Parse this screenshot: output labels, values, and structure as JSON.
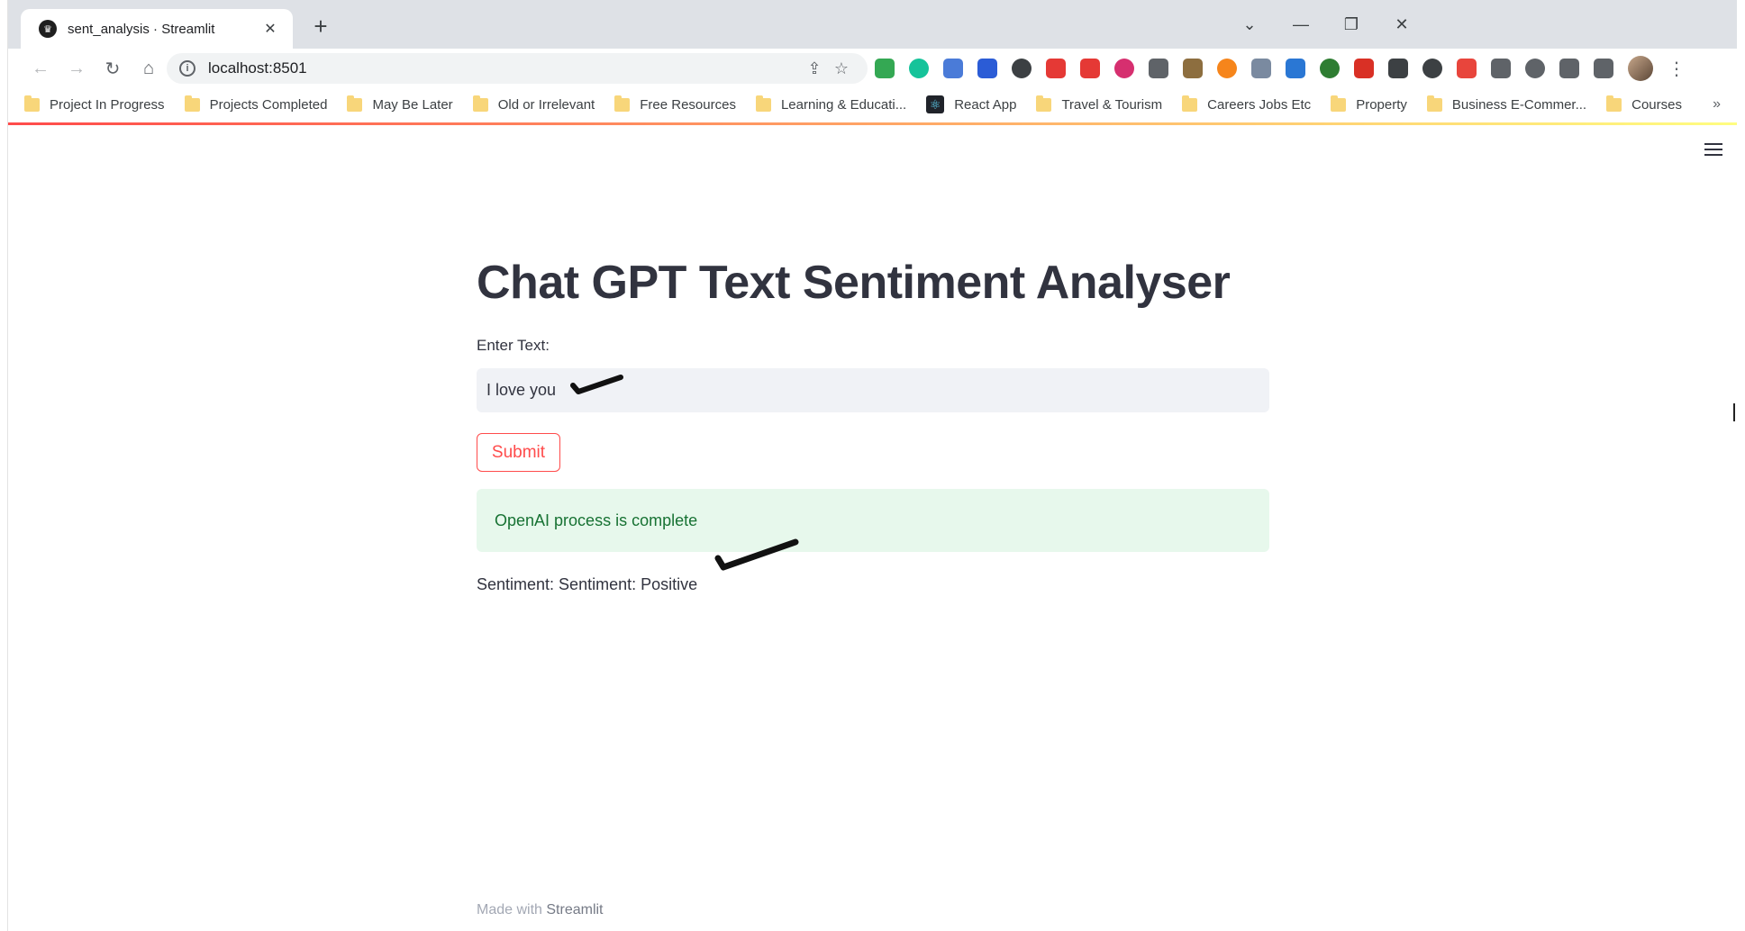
{
  "browser": {
    "tab_title": "sent_analysis · Streamlit",
    "url": "localhost:8501",
    "bookmarks": [
      {
        "label": "Project In Progress",
        "type": "folder"
      },
      {
        "label": "Projects Completed",
        "type": "folder"
      },
      {
        "label": "May Be Later",
        "type": "folder"
      },
      {
        "label": "Old or Irrelevant",
        "type": "folder"
      },
      {
        "label": "Free Resources",
        "type": "folder"
      },
      {
        "label": "Learning & Educati...",
        "type": "folder"
      },
      {
        "label": "React App",
        "type": "react"
      },
      {
        "label": "Travel & Tourism",
        "type": "folder"
      },
      {
        "label": "Careers Jobs Etc",
        "type": "folder"
      },
      {
        "label": "Property",
        "type": "folder"
      },
      {
        "label": "Business E-Commer...",
        "type": "folder"
      },
      {
        "label": "Courses",
        "type": "folder"
      }
    ],
    "bookmarks_more": "»",
    "extensions": [
      "#34a853",
      "#15c39a",
      "#4a7bd8",
      "#2b5cd6",
      "#3c4043",
      "#e53935",
      "#e53935",
      "#d62f6f",
      "#5f6368",
      "#8d6e3f",
      "#f6851b",
      "#7a8aa0",
      "#2a77d4",
      "#2e7d32",
      "#d93025",
      "#3c4043",
      "#3c4043",
      "#e8453c",
      "#5f6368",
      "#5f6368",
      "#5f6368",
      "#5f6368"
    ]
  },
  "app": {
    "title": "Chat GPT Text Sentiment Analyser",
    "input_label": "Enter Text:",
    "input_value": "I love you",
    "submit_label": "Submit",
    "success_message": "OpenAI process is complete",
    "result": "Sentiment: Sentiment: Positive",
    "footer_prefix": "Made with ",
    "footer_brand": "Streamlit"
  },
  "colors": {
    "accent": "#ff4b4b",
    "success_bg": "#e7f8ec",
    "success_text": "#177233",
    "text": "#31333f"
  }
}
